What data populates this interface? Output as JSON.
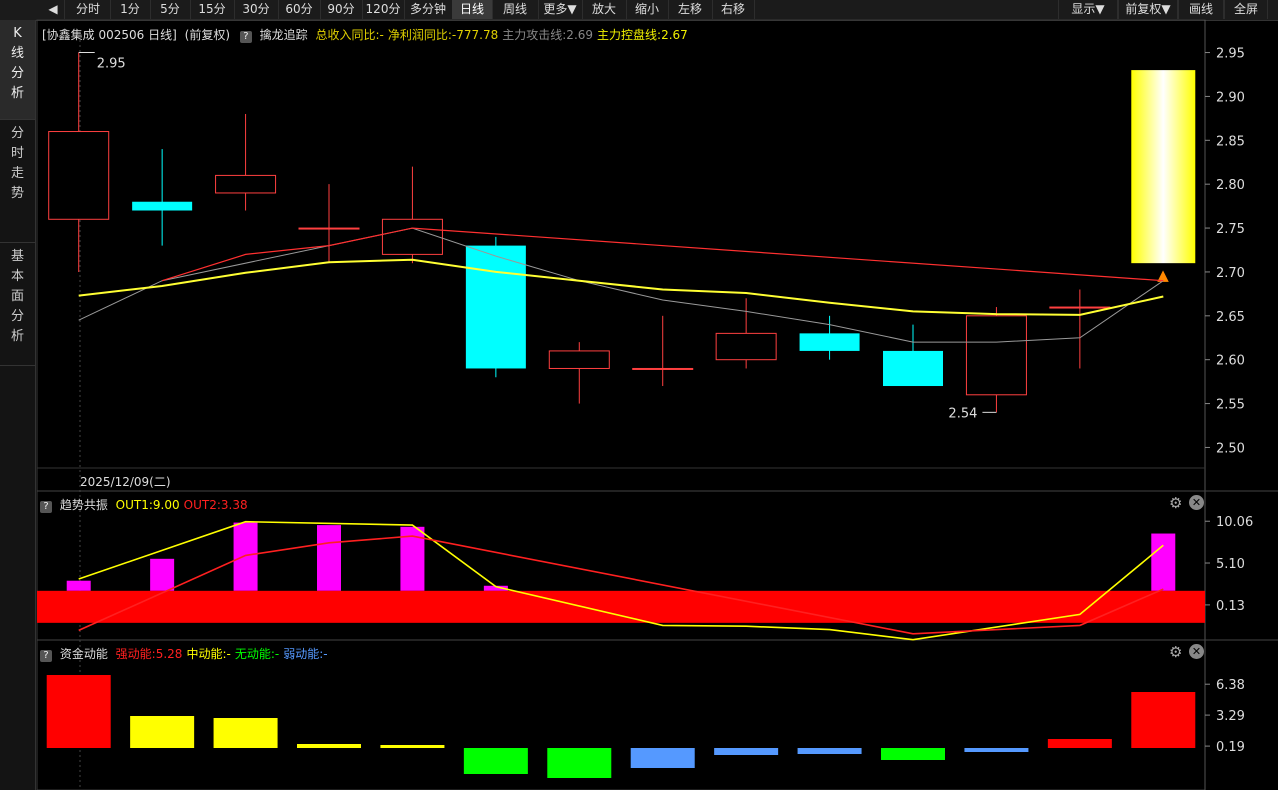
{
  "toolbar": {
    "items": [
      "分时",
      "1分",
      "5分",
      "15分",
      "30分",
      "60分",
      "90分",
      "120分",
      "多分钟",
      "日线",
      "周线",
      "更多▼",
      "放大",
      "缩小",
      "左移",
      "右移"
    ],
    "active_index": 9,
    "right_items": [
      "显示▼",
      "前复权▼",
      "画线",
      "全屏"
    ]
  },
  "sidebar": {
    "tabs": [
      {
        "chars": [
          "K",
          "线",
          "分",
          "析"
        ]
      },
      {
        "chars": [
          "分",
          "时",
          "走",
          "势"
        ]
      },
      {
        "chars": [
          "基",
          "本",
          "面",
          "分",
          "析"
        ]
      }
    ]
  },
  "main_header": {
    "stock": "[协鑫集成 002506 日线]",
    "adjust": "(前复权)",
    "indicator": "擒龙追踪",
    "items": [
      {
        "text": "总收入同比:-",
        "color": "#e0d000"
      },
      {
        "text": "净利润同比:-777.78",
        "color": "#e0d000"
      },
      {
        "text": "主力攻击线:2.69",
        "color": "#888888"
      },
      {
        "text": "主力控盘线:2.67",
        "color": "#f0f000"
      }
    ]
  },
  "date_label": "2025/12/09(二)",
  "panel2_header": {
    "name": "趋势共振",
    "items": [
      {
        "text": "OUT1:9.00",
        "color": "#ffff00"
      },
      {
        "text": "OUT2:3.38",
        "color": "#ff2020"
      }
    ]
  },
  "panel3_header": {
    "name": "资金动能",
    "items": [
      {
        "text": "强动能:5.28",
        "color": "#ff2020"
      },
      {
        "text": "中动能:-",
        "color": "#ffff00"
      },
      {
        "text": "无动能:-",
        "color": "#00ff00"
      },
      {
        "text": "弱动能:-",
        "color": "#5599ff"
      }
    ]
  },
  "chart_data": [
    {
      "type": "candlestick",
      "title": "协鑫集成 002506 日线",
      "ylim": [
        2.48,
        2.97
      ],
      "y_ticks": [
        "2.95",
        "2.90",
        "2.85",
        "2.80",
        "2.75",
        "2.70",
        "2.65",
        "2.60",
        "2.55",
        "2.50"
      ],
      "high_label": "2.95",
      "low_label": "2.54",
      "colors": {
        "up": "#ff4040",
        "down": "#00ffff",
        "ma_fast": "#ff3030",
        "ma_mid": "#ffff33",
        "ma_slow": "#999999"
      },
      "candles": [
        {
          "open": 2.76,
          "close": 2.86,
          "high": 2.95,
          "low": 2.7
        },
        {
          "open": 2.78,
          "close": 2.77,
          "high": 2.84,
          "low": 2.73
        },
        {
          "open": 2.79,
          "close": 2.81,
          "high": 2.88,
          "low": 2.77
        },
        {
          "open": 2.75,
          "close": 2.75,
          "high": 2.8,
          "low": 2.71
        },
        {
          "open": 2.72,
          "close": 2.76,
          "high": 2.82,
          "low": 2.71
        },
        {
          "open": 2.73,
          "close": 2.59,
          "high": 2.74,
          "low": 2.58
        },
        {
          "open": 2.59,
          "close": 2.61,
          "high": 2.62,
          "low": 2.55
        },
        {
          "open": 2.59,
          "close": 2.59,
          "high": 2.65,
          "low": 2.57
        },
        {
          "open": 2.6,
          "close": 2.63,
          "high": 2.67,
          "low": 2.59
        },
        {
          "open": 2.63,
          "close": 2.61,
          "high": 2.65,
          "low": 2.6
        },
        {
          "open": 2.61,
          "close": 2.57,
          "high": 2.64,
          "low": 2.57
        },
        {
          "open": 2.56,
          "close": 2.65,
          "high": 2.66,
          "low": 2.54
        },
        {
          "open": 2.66,
          "close": 2.66,
          "high": 2.68,
          "low": 2.59
        }
      ],
      "signal_box": {
        "bottom": 2.71,
        "top": 2.93
      },
      "ma_fast": [
        null,
        2.69,
        2.72,
        2.73,
        2.75,
        null,
        null,
        null,
        null,
        null,
        null,
        null,
        null,
        2.69
      ],
      "ma_mid": [
        2.673,
        2.684,
        2.699,
        2.711,
        2.714,
        2.7,
        2.69,
        2.68,
        2.676,
        2.665,
        2.655,
        2.652,
        2.651,
        2.672
      ],
      "ma_slow": [
        2.645,
        2.69,
        null,
        null,
        2.75,
        2.718,
        2.69,
        2.668,
        2.655,
        2.64,
        2.62,
        2.62,
        2.625,
        2.69
      ]
    },
    {
      "type": "bar",
      "title": "趋势共振",
      "ylim": [
        -3.8,
        10.8
      ],
      "y_ticks": [
        "10.06",
        "5.10",
        "0.13"
      ],
      "band": {
        "low": -2.0,
        "high": 1.8,
        "color": "#ff0000"
      },
      "bars": [
        3.0,
        5.6,
        9.9,
        9.6,
        9.4,
        2.4,
        null,
        null,
        null,
        null,
        null,
        null,
        null,
        8.6
      ],
      "series": [
        {
          "name": "OUT1",
          "color": "#ffff00",
          "values": [
            3.2,
            null,
            10.0,
            null,
            9.6,
            2.3,
            null,
            -2.3,
            -2.4,
            -2.8,
            -4.0,
            null,
            -1.0,
            7.2
          ]
        },
        {
          "name": "OUT2",
          "color": "#ff2020",
          "values": [
            -2.9,
            null,
            6.0,
            7.5,
            8.3,
            null,
            null,
            null,
            null,
            null,
            -3.3,
            null,
            -2.3,
            2.0
          ]
        }
      ]
    },
    {
      "type": "bar",
      "title": "资金动能",
      "ylim": [
        -4.2,
        8.6
      ],
      "y_ticks": [
        "6.38",
        "3.29",
        "0.19"
      ],
      "bars": [
        {
          "value": 7.3,
          "color": "#ff0000"
        },
        {
          "value": 3.2,
          "color": "#ffff00"
        },
        {
          "value": 3.0,
          "color": "#ffff00"
        },
        {
          "value": 0.4,
          "color": "#ffff00"
        },
        {
          "value": 0.3,
          "color": "#ffff00"
        },
        {
          "value": -2.6,
          "color": "#00ff00"
        },
        {
          "value": -3.0,
          "color": "#00ff00"
        },
        {
          "value": -2.0,
          "color": "#5599ff"
        },
        {
          "value": -0.7,
          "color": "#5599ff"
        },
        {
          "value": -0.6,
          "color": "#5599ff"
        },
        {
          "value": -1.2,
          "color": "#00ff00"
        },
        {
          "value": -0.4,
          "color": "#5599ff"
        },
        {
          "value": 0.9,
          "color": "#ff0000"
        },
        {
          "value": 5.6,
          "color": "#ff0000"
        }
      ]
    }
  ]
}
